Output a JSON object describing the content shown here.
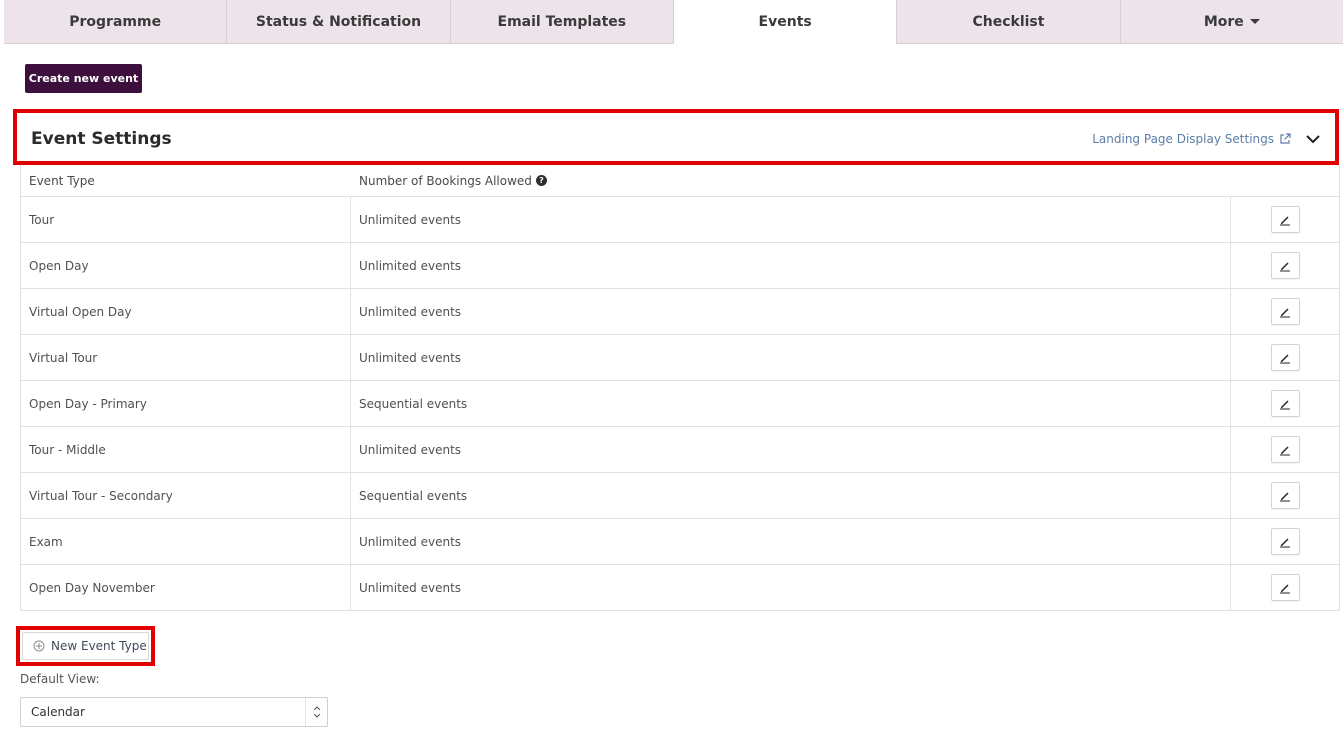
{
  "tabs": [
    {
      "label": "Programme"
    },
    {
      "label": "Status & Notification"
    },
    {
      "label": "Email Templates"
    },
    {
      "label": "Events",
      "active": true
    },
    {
      "label": "Checklist"
    },
    {
      "label": "More"
    }
  ],
  "create_button": "Create new event",
  "event_settings": {
    "title": "Event Settings",
    "landing_link": "Landing Page Display Settings"
  },
  "table": {
    "headers": [
      "Event Type",
      "Number of Bookings Allowed"
    ],
    "rows": [
      {
        "type": "Tour",
        "bookings": "Unlimited events"
      },
      {
        "type": "Open Day",
        "bookings": "Unlimited events"
      },
      {
        "type": "Virtual Open Day",
        "bookings": "Unlimited events"
      },
      {
        "type": "Virtual Tour",
        "bookings": "Unlimited events"
      },
      {
        "type": "Open Day - Primary",
        "bookings": "Sequential events"
      },
      {
        "type": "Tour - Middle",
        "bookings": "Unlimited events"
      },
      {
        "type": "Virtual Tour - Secondary",
        "bookings": "Sequential events"
      },
      {
        "type": "Exam",
        "bookings": "Unlimited events"
      },
      {
        "type": "Open Day November",
        "bookings": "Unlimited events"
      }
    ]
  },
  "new_event_type": "New Event Type",
  "default_view": {
    "label": "Default View:",
    "value": "Calendar"
  },
  "colors": {
    "accent": "#3c0f3c",
    "highlight": "#e00000",
    "link": "#5b7ea8",
    "tab_bg": "#ece4ea"
  }
}
